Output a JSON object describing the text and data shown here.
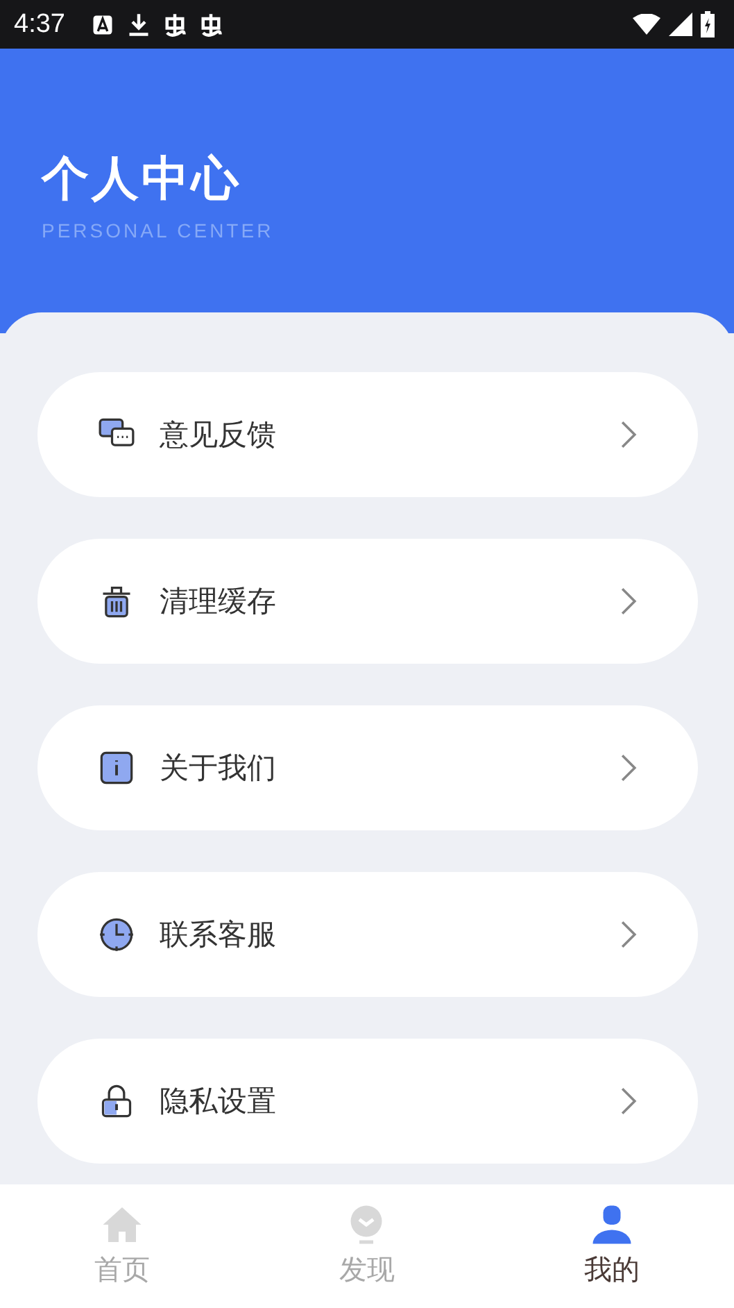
{
  "status_bar": {
    "time": "4:37"
  },
  "header": {
    "title": "个人中心",
    "subtitle": "PERSONAL CENTER"
  },
  "menu": [
    {
      "kind": "feedback",
      "label": "意见反馈"
    },
    {
      "kind": "clean",
      "label": "清理缓存"
    },
    {
      "kind": "about",
      "label": "关于我们"
    },
    {
      "kind": "service",
      "label": "联系客服"
    },
    {
      "kind": "privacy",
      "label": "隐私设置"
    }
  ],
  "tabs": [
    {
      "kind": "home",
      "label": "首页",
      "selected": false
    },
    {
      "kind": "discover",
      "label": "发现",
      "selected": false
    },
    {
      "kind": "mine",
      "label": "我的",
      "selected": true
    }
  ]
}
